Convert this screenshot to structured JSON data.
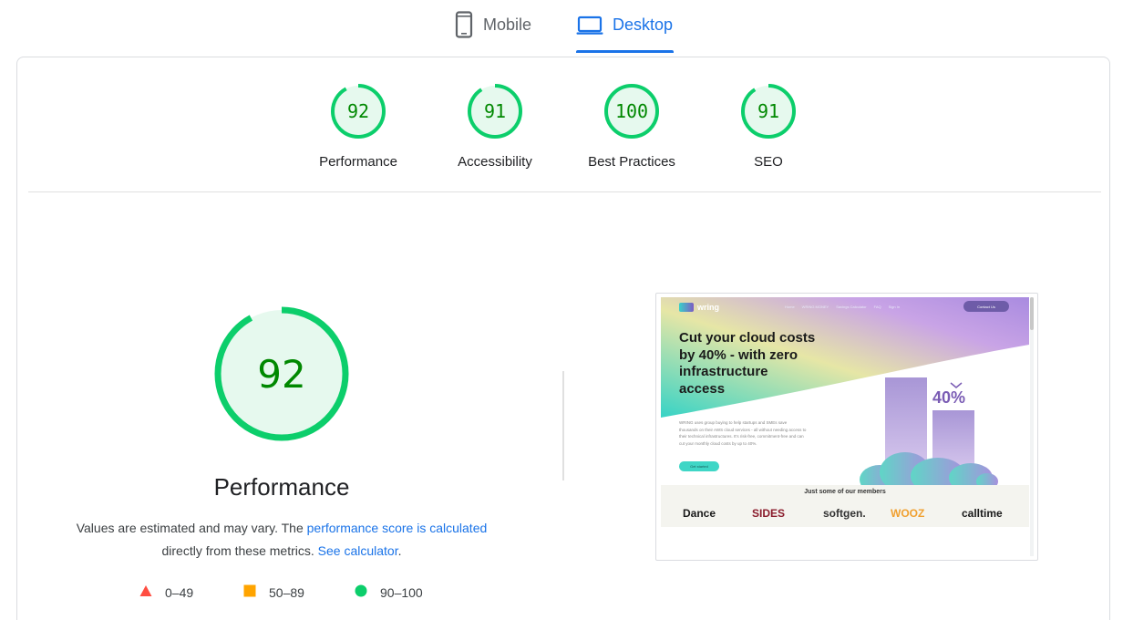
{
  "tabs": {
    "mobile": "Mobile",
    "desktop": "Desktop",
    "active": "Desktop"
  },
  "gauges": [
    {
      "score": "92",
      "label": "Performance"
    },
    {
      "score": "91",
      "label": "Accessibility"
    },
    {
      "score": "100",
      "label": "Best Practices"
    },
    {
      "score": "91",
      "label": "SEO"
    }
  ],
  "performance": {
    "score": "92",
    "title": "Performance",
    "desc_part1": "Values are estimated and may vary. The ",
    "desc_link1": "performance score is calculated",
    "desc_part2": "directly from these metrics. ",
    "desc_link2": "See calculator",
    "desc_part3": "."
  },
  "legend": [
    {
      "range": "0–49",
      "color": "#ff4e42",
      "shape": "triangle-icon"
    },
    {
      "range": "50–89",
      "color": "#ffa400",
      "shape": "square-icon"
    },
    {
      "range": "90–100",
      "color": "#0cce6b",
      "shape": "circle-icon"
    }
  ],
  "colors": {
    "pass": "#0cce6b",
    "pass_text": "#008800",
    "pass_bg": "#e6f9ee",
    "accent": "#1a73e8"
  },
  "screenshot": {
    "logo": "wring",
    "nav_links": [
      "Home",
      "WRING MONEY",
      "Savings Calculator",
      "FAQ",
      "Sign In"
    ],
    "nav_cta": "Contact Us",
    "headline": "Cut your cloud costs by 40% - with zero infrastructure access",
    "body": "WRING uses group buying to help startups and SMEs save thousands on their AWS cloud services - all without needing access to their technical infrastructures. It's risk-free, commitment-free and can cut your monthly cloud costs by up to 40%.",
    "cta": "Get started",
    "percent": "40%",
    "members_title": "Just some of our members",
    "members": [
      "Dance",
      "SIDES",
      "softgen.",
      "WOOZ",
      "calltime"
    ]
  }
}
